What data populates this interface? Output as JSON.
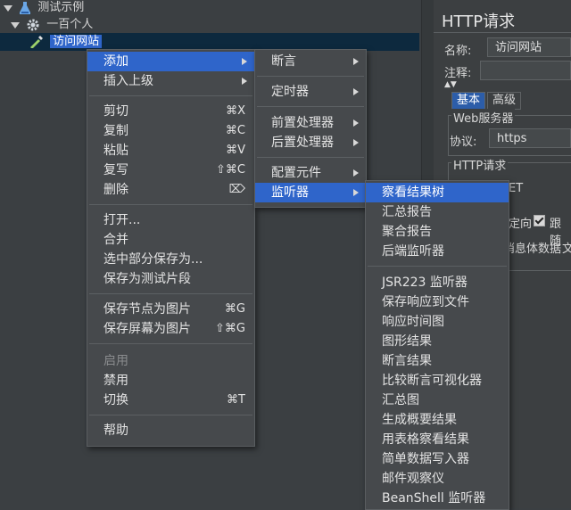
{
  "tree": {
    "root_label": "测试示例",
    "group_label": "一百个人",
    "selected_label": "访问网站"
  },
  "menu_main": {
    "add": "添加",
    "insert_parent": "插入上级",
    "cut": "剪切",
    "cut_sc": "⌘X",
    "copy": "复制",
    "copy_sc": "⌘C",
    "paste": "粘贴",
    "paste_sc": "⌘V",
    "duplicate": "复写",
    "duplicate_sc": "⇧⌘C",
    "delete": "删除",
    "delete_sc": "⌦",
    "open": "打开...",
    "merge": "合并",
    "save_selection": "选中部分保存为...",
    "save_fragment": "保存为测试片段",
    "save_node_image": "保存节点为图片",
    "save_node_image_sc": "⌘G",
    "save_screen_image": "保存屏幕为图片",
    "save_screen_image_sc": "⇧⌘G",
    "enable": "启用",
    "disable": "禁用",
    "toggle": "切换",
    "toggle_sc": "⌘T",
    "help": "帮助"
  },
  "menu_add": {
    "assertion": "断言",
    "timer": "定时器",
    "pre_processor": "前置处理器",
    "post_processor": "后置处理器",
    "config_element": "配置元件",
    "listener": "监听器"
  },
  "menu_listener": {
    "items": [
      "察看结果树",
      "汇总报告",
      "聚合报告",
      "后端监听器",
      "JSR223 监听器",
      "保存响应到文件",
      "响应时间图",
      "图形结果",
      "断言结果",
      "比较断言可视化器",
      "汇总图",
      "生成概要结果",
      "用表格察看结果",
      "简单数据写入器",
      "邮件观察仪",
      "BeanShell 监听器"
    ]
  },
  "right_panel": {
    "title": "HTTP请求",
    "name_label": "名称:",
    "name_value": "访问网站",
    "comment_label": "注释:",
    "tab_basic": "基本",
    "tab_advanced": "高级",
    "web_server_label": "Web服务器",
    "protocol_label": "协议:",
    "protocol_value": "https",
    "http_request_label": "HTTP请求",
    "method_partial": "ET",
    "redirect_partial": "定向",
    "follow_partial": "跟随",
    "body_partial": "消息体数据",
    "files_partial": "文"
  },
  "colors": {
    "highlight": "#2f65ca",
    "menu_bg": "#46494c",
    "panel_bg": "#3b3f42"
  }
}
